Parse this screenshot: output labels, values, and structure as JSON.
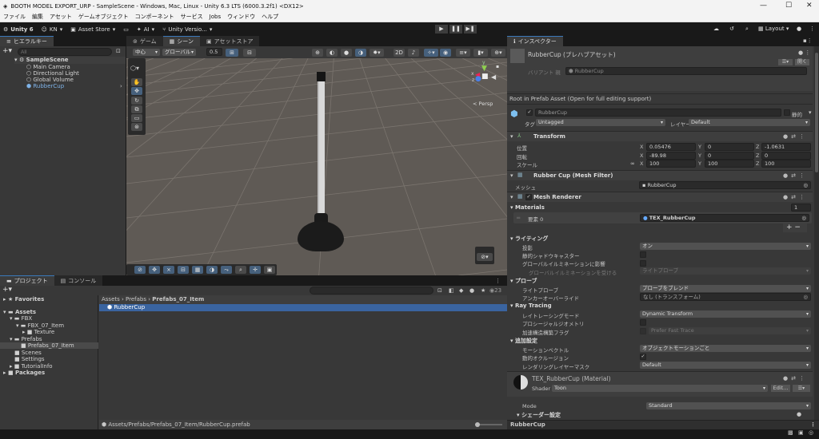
{
  "window": {
    "title": "BOOTH MODEL EXPORT_URP - SampleScene - Windows, Mac, Linux - Unity 6.3 LTS (6000.3.2f1) <DX12>",
    "minimize": "—",
    "maximize": "☐",
    "close": "✕"
  },
  "menu": [
    "ファイル",
    "編集",
    "アセット",
    "ゲームオブジェクト",
    "コンポーネント",
    "サービス",
    "Jobs",
    "ウィンドウ",
    "ヘルプ"
  ],
  "toolbar": {
    "unity": "Unity 6",
    "account": "KN",
    "asset_store": "Asset Store",
    "ai": "AI",
    "version_control": "Unity Versio...",
    "layout": "Layout",
    "play": "▶",
    "pause": "❚❚",
    "step": "▶❚"
  },
  "hierarchy": {
    "tab": "ヒエラルキー",
    "search_placeholder": "All",
    "scene": "SampleScene",
    "items": [
      "Main Camera",
      "Directional Light",
      "Global Volume",
      "RubberCup"
    ]
  },
  "scene": {
    "tabs": [
      "ゲーム",
      "シーン",
      "アセットストア"
    ],
    "pivot": "中心",
    "space": "グローバル",
    "snap": "0.5",
    "persp": "< Persp",
    "gizmo_y": "y",
    "gizmo_x": "x",
    "gizmo_z": "z"
  },
  "project": {
    "tabs": [
      "プロジェクト",
      "コンソール"
    ],
    "favorites": "Favorites",
    "tree": [
      "Assets",
      "FBX",
      "FBX_07_Item",
      "Texture",
      "Prefabs",
      "Prefabs_07_Item",
      "Scenes",
      "Settings",
      "TutorialInfo",
      "Packages"
    ],
    "breadcrumb": [
      "Assets",
      "Prefabs",
      "Prefabs_07_Item"
    ],
    "files": [
      "RubberCup"
    ],
    "hidden_count": "23",
    "path": "Assets/Prefabs/Prefabs_07_Item/RubberCup.prefab"
  },
  "inspector": {
    "tab": "インスペクター",
    "asset_title": "RubberCup (プレハブアセット)",
    "open_button": "開く",
    "variant_label": "バリアント 親",
    "variant_value": "RubberCup",
    "root_note": "Root in Prefab Asset (Open for full editing support)",
    "name": "RubberCup",
    "static_label": "静的",
    "tag_label": "タグ",
    "tag": "Untagged",
    "layer_label": "レイヤー",
    "layer": "Default",
    "transform": {
      "title": "Transform",
      "rows": [
        {
          "label": "位置",
          "x": "0.05476",
          "y": "0",
          "z": "-1.0631"
        },
        {
          "label": "回転",
          "x": "-89.98",
          "y": "0",
          "z": "0"
        },
        {
          "label": "スケール",
          "x": "100",
          "y": "100",
          "z": "100"
        }
      ]
    },
    "mesh_filter": {
      "title": "Rubber Cup (Mesh Filter)",
      "mesh_label": "メッシュ",
      "mesh": "RubberCup"
    },
    "mesh_renderer": {
      "title": "Mesh Renderer",
      "materials": "Materials",
      "count": "1",
      "element_label": "要素 0",
      "element": "TEX_RubberCup",
      "lighting": "ライティング",
      "cast_shadows_label": "投影",
      "cast_shadows": "オン",
      "static_shadow": "静的シャドウキャスター",
      "contribute_gi": "グローバルイルミネーションに影響",
      "receive_gi_label": "グローバルイルミネーションを受ける",
      "receive_gi": "ライトプローブ",
      "probes": "プローブ",
      "light_probes_label": "ライトプローブ",
      "light_probes": "プローブをブレンド",
      "anchor_label": "アンカーオーバーライド",
      "anchor": "なし (トランスフォーム)",
      "ray_tracing": "Ray Tracing",
      "rt_mode_label": "レイトレーシングモード",
      "rt_mode": "Dynamic Transform",
      "procedural_label": "プロシージャルジオメトリ",
      "accel_label": "加速構造構築フラグ",
      "accel": "Prefer Fast Trace",
      "additional": "追加設定",
      "motion_label": "モーションベクトル",
      "motion": "オブジェクトモーションごと",
      "occlusion_label": "動的オクルージョン",
      "layer_mask_label": "レンダリングレイヤーマスク",
      "layer_mask": "Default"
    },
    "material": {
      "title": "TEX_RubberCup (Material)",
      "shader_label": "Shader",
      "shader": "Toon",
      "edit": "Edit...",
      "mode_label": "Mode",
      "mode": "Standard",
      "shader_settings": "シェーダー設定"
    },
    "preview": "RubberCup"
  },
  "colors": {
    "accent": "#3a79bb",
    "selection": "#2c5d87",
    "panel": "#383838"
  }
}
